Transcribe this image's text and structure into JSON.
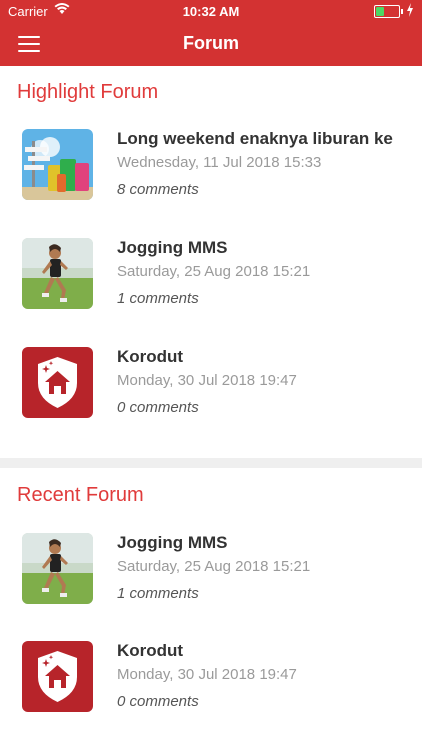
{
  "status_bar": {
    "carrier": "Carrier",
    "time": "10:32 AM",
    "battery_level": 0.35
  },
  "navbar": {
    "title": "Forum",
    "menu_icon": "hamburger-menu-icon"
  },
  "colors": {
    "brand": "#d33232",
    "accent_text": "#e03b3b",
    "muted": "#9a9a9a"
  },
  "highlight": {
    "heading": "Highlight Forum",
    "items": [
      {
        "title": "Long weekend enaknya liburan ke",
        "date": "Wednesday, 11 Jul 2018 15:33",
        "comments": "8 comments",
        "thumb": "travel-suitcases-image"
      },
      {
        "title": "Jogging MMS",
        "date": "Saturday, 25 Aug 2018 15:21",
        "comments": "1 comments",
        "thumb": "jogging-woman-image"
      },
      {
        "title": "Korodut",
        "date": "Monday, 30 Jul 2018 19:47",
        "comments": "0 comments",
        "thumb": "shield-house-icon"
      }
    ]
  },
  "recent": {
    "heading": "Recent Forum",
    "items": [
      {
        "title": "Jogging MMS",
        "date": "Saturday, 25 Aug 2018 15:21",
        "comments": "1 comments",
        "thumb": "jogging-woman-image"
      },
      {
        "title": "Korodut",
        "date": "Monday, 30 Jul 2018 19:47",
        "comments": "0 comments",
        "thumb": "shield-house-icon"
      }
    ]
  }
}
